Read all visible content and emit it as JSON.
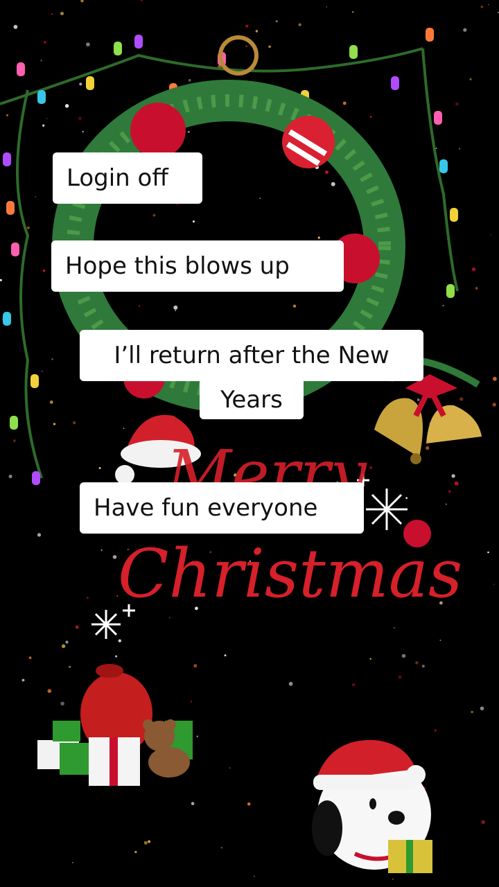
{
  "captions": {
    "c1": "Login off",
    "c2": "Hope this blows up",
    "c3_line1": "I’ll return after the New",
    "c3_line2": "Years",
    "c4": "Have fun everyone"
  },
  "greeting": {
    "word1": "Merry",
    "word2": "Christmas"
  },
  "colors": {
    "background": "#000000",
    "caption_bg": "#ffffff",
    "caption_text": "#111111",
    "script_red": "#d6202a",
    "wreath_green": "#2f7a3a",
    "ornament_red": "#c8102e"
  },
  "icons": [
    "wreath-icon",
    "christmas-lights-icon",
    "bells-icon",
    "santa-hat-icon",
    "snowflake-icon",
    "gift-sack-icon",
    "teddy-bear-icon",
    "snoopy-santa-icon"
  ]
}
